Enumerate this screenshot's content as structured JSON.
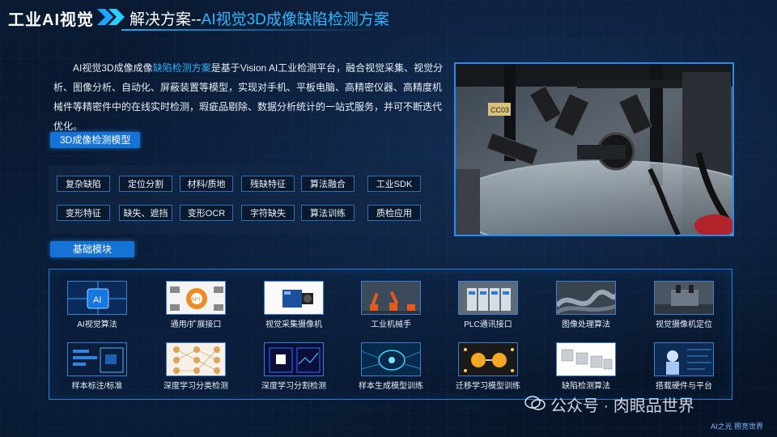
{
  "header": {
    "brand": "工业AI视觉",
    "title_prefix": "解决方案--",
    "title_accent": "AI视觉3D成像缺陷检测方案"
  },
  "intro": {
    "part1": "AI视觉3D成像成像",
    "highlight": "缺陷检测方案",
    "part2": "是基于Vision AI工业检测平台，融合视觉采集、视觉分析、图像分析、自动化、屏蔽装置等模型，实现对手机、平板电脑、高精密仪器、高精度机械件等精密件中的在线实时检测，瑕疵品剔除、数据分析统计的一站式服务，并可不断迭代优化。"
  },
  "model_section": {
    "title": "3D成像检测模型",
    "tags": [
      "复杂缺陷",
      "定位分割",
      "材料/质地",
      "残缺特征",
      "算法融合",
      "工业SDK",
      "变形特征",
      "缺失、遮挡",
      "变形OCR",
      "字符缺失",
      "算法训练",
      "质检应用"
    ]
  },
  "base_section": {
    "title": "基础模块",
    "modules": [
      {
        "label": "AI视觉算法",
        "icon": "ai-chip-icon"
      },
      {
        "label": "通用/扩展接口",
        "icon": "api-gear-icon"
      },
      {
        "label": "视觉采集摄像机",
        "icon": "camera-icon"
      },
      {
        "label": "工业机械手",
        "icon": "robot-arm-icon"
      },
      {
        "label": "PLC通讯接口",
        "icon": "plc-icon"
      },
      {
        "label": "图像处理算法",
        "icon": "image-processing-icon"
      },
      {
        "label": "视觉摄像机定位",
        "icon": "camera-positioning-icon"
      },
      {
        "label": "样本标注/标准",
        "icon": "annotation-icon"
      },
      {
        "label": "深度学习分类检测",
        "icon": "neural-network-icon"
      },
      {
        "label": "深度学习分割检测",
        "icon": "segmentation-icon"
      },
      {
        "label": "样本生成模型训练",
        "icon": "brain-circuit-icon"
      },
      {
        "label": "迁移学习模型训练",
        "icon": "transfer-learning-icon"
      },
      {
        "label": "缺陷检测算法",
        "icon": "defect-detection-icon"
      },
      {
        "label": "搭载硬件与平台",
        "icon": "hardware-platform-icon"
      }
    ]
  },
  "photo": {
    "label": "CC03"
  },
  "watermark": "公众号 · 肉眼品世界",
  "footer": "AI之光 照亮世界",
  "colors": {
    "accent": "#2fb7ff",
    "badge": "#1673d6",
    "frame": "#1e7fe0",
    "background": "#071427"
  }
}
